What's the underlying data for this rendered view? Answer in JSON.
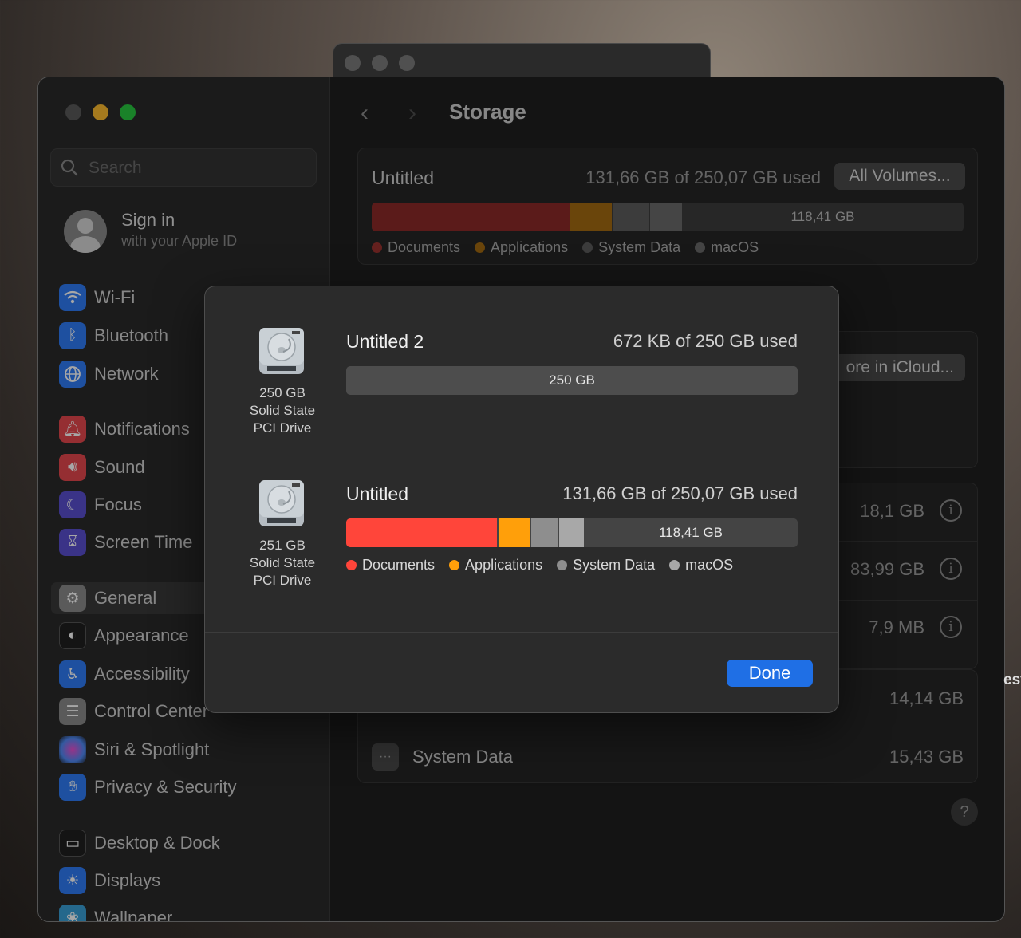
{
  "window": {
    "title": "Storage",
    "traffic_lights": {
      "close": "#5a5a5a",
      "minimize": "#febc2e",
      "zoom": "#28c840"
    }
  },
  "sidebar": {
    "search_placeholder": "Search",
    "account": {
      "title": "Sign in",
      "subtitle": "with your Apple ID"
    },
    "items": [
      {
        "label": "Wi-Fi",
        "icon": "wifi-icon",
        "color": "#2f7cf6"
      },
      {
        "label": "Bluetooth",
        "icon": "bluetooth-icon",
        "color": "#2f7cf6"
      },
      {
        "label": "Network",
        "icon": "globe-icon",
        "color": "#2f7cf6"
      },
      {
        "label": "Notifications",
        "icon": "bell-icon",
        "color": "#e5484d"
      },
      {
        "label": "Sound",
        "icon": "speaker-icon",
        "color": "#e5484d"
      },
      {
        "label": "Focus",
        "icon": "moon-icon",
        "color": "#5a4fcf"
      },
      {
        "label": "Screen Time",
        "icon": "hourglass-icon",
        "color": "#5a4fcf"
      },
      {
        "label": "General",
        "icon": "gear-icon",
        "color": "#8a8a8a"
      },
      {
        "label": "Appearance",
        "icon": "appearance-icon",
        "color": "#1f1f1f"
      },
      {
        "label": "Accessibility",
        "icon": "accessibility-icon",
        "color": "#2f7cf6"
      },
      {
        "label": "Control Center",
        "icon": "switches-icon",
        "color": "#8a8a8a"
      },
      {
        "label": "Siri & Spotlight",
        "icon": "siri-icon",
        "color": "#b04fd1"
      },
      {
        "label": "Privacy & Security",
        "icon": "hand-icon",
        "color": "#2f7cf6"
      },
      {
        "label": "Desktop & Dock",
        "icon": "dock-icon",
        "color": "#1f1f1f"
      },
      {
        "label": "Displays",
        "icon": "sun-icon",
        "color": "#2f7cf6"
      },
      {
        "label": "Wallpaper",
        "icon": "wallpaper-icon",
        "color": "#3aa0d8"
      }
    ],
    "selected": "General"
  },
  "storage": {
    "volume_name": "Untitled",
    "used_text": "131,66 GB of 250,07 GB used",
    "all_volumes_button": "All Volumes...",
    "free_label": "118,41 GB",
    "usage_fractions": {
      "documents": 0.335,
      "applications": 0.07,
      "system_data": 0.06,
      "macos": 0.055
    },
    "legend": [
      {
        "label": "Documents",
        "color": "#ff453a"
      },
      {
        "label": "Applications",
        "color": "#ff9f0a"
      },
      {
        "label": "System Data",
        "color": "#8e8e8e"
      },
      {
        "label": "macOS",
        "color": "#a8a8a8"
      }
    ],
    "icloud_button": "ore in iCloud...",
    "rows": [
      {
        "value": "18,1 GB"
      },
      {
        "value": "83,99 GB"
      },
      {
        "value": "7,9 MB"
      },
      {
        "value": "14,14 GB"
      },
      {
        "label": "System Data",
        "value": "15,43 GB"
      }
    ],
    "partial_text": "est",
    "help": "?"
  },
  "modal": {
    "drives": [
      {
        "caption": [
          "250 GB",
          "Solid State",
          "PCI Drive"
        ],
        "volume": "Untitled 2",
        "used_text": "672 KB of 250 GB used",
        "bar_label": "250 GB"
      },
      {
        "caption": [
          "251 GB",
          "Solid State",
          "PCI Drive"
        ],
        "volume": "Untitled",
        "used_text": "131,66 GB of 250,07 GB used",
        "bar_label": "118,41 GB"
      }
    ],
    "done_button": "Done"
  }
}
